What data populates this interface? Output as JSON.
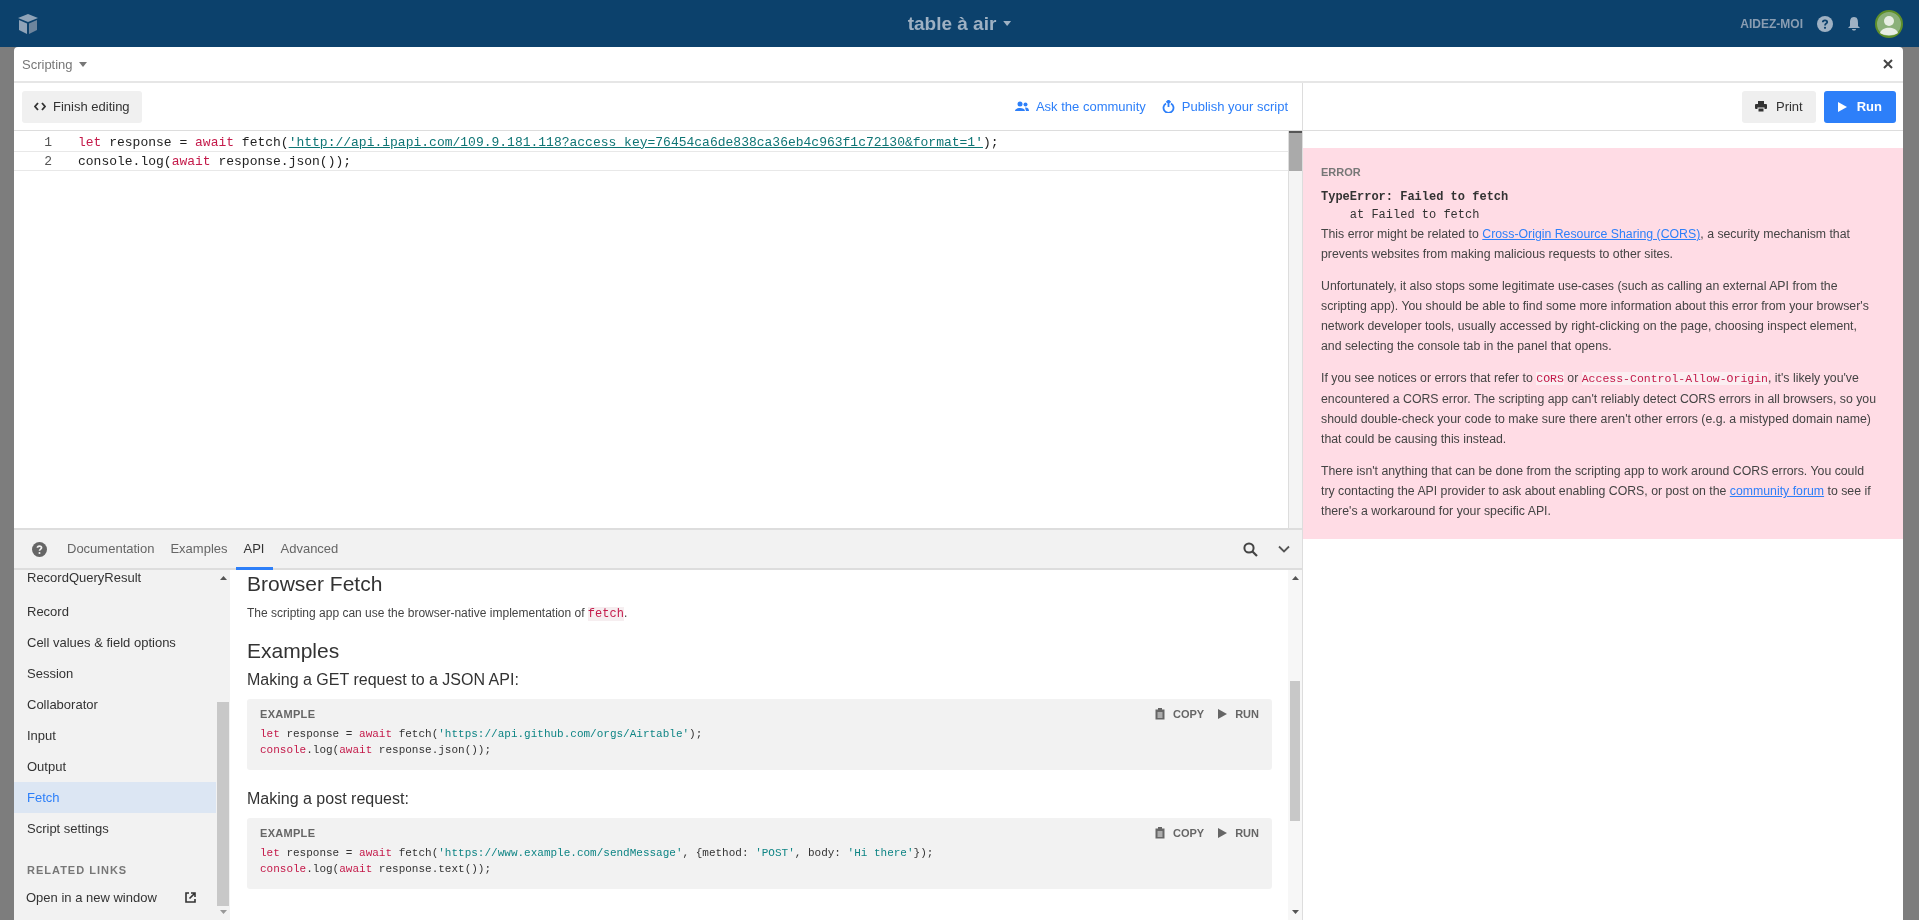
{
  "top_bar": {
    "title": "table à air",
    "help_label": "AIDEZ-MOI"
  },
  "modal": {
    "title": "Scripting"
  },
  "toolbar": {
    "finish_editing": "Finish editing",
    "ask_community": "Ask the community",
    "publish_script": "Publish your script"
  },
  "run_panel": {
    "print": "Print",
    "run": "Run"
  },
  "editor": {
    "lines": [
      {
        "number": "1",
        "tokens": [
          {
            "kind": "keyword",
            "text": "let"
          },
          {
            "kind": "plain",
            "text": " response = "
          },
          {
            "kind": "keyword",
            "text": "await"
          },
          {
            "kind": "plain",
            "text": " fetch("
          },
          {
            "kind": "link-string",
            "text": "'http://api.ipapi.com/109.9.181.118?access_key=76454ca6de838ca36eb4c963f1c72130&format=1'"
          },
          {
            "kind": "plain",
            "text": ");"
          }
        ]
      },
      {
        "number": "2",
        "tokens": [
          {
            "kind": "plain",
            "text": "console.log("
          },
          {
            "kind": "keyword",
            "text": "await"
          },
          {
            "kind": "plain",
            "text": " response.json());"
          }
        ]
      }
    ]
  },
  "docs": {
    "tabs": [
      {
        "label": "Documentation",
        "selected": false
      },
      {
        "label": "Examples",
        "selected": false
      },
      {
        "label": "API",
        "selected": true
      },
      {
        "label": "Advanced",
        "selected": false
      }
    ],
    "sidebar": {
      "items": [
        {
          "label": "RecordQueryResult",
          "selected": false
        },
        {
          "label": "Record",
          "selected": false
        },
        {
          "label": "Cell values & field options",
          "selected": false
        },
        {
          "label": "Session",
          "selected": false
        },
        {
          "label": "Collaborator",
          "selected": false
        },
        {
          "label": "Input",
          "selected": false
        },
        {
          "label": "Output",
          "selected": false
        },
        {
          "label": "Fetch",
          "selected": true
        },
        {
          "label": "Script settings",
          "selected": false
        }
      ],
      "related_heading": "RELATED LINKS",
      "related_links": [
        {
          "label": "Open in a new window"
        }
      ]
    },
    "content": {
      "heading": "Browser Fetch",
      "intro": [
        {
          "kind": "text",
          "text": "The scripting app can use the browser-native implementation of "
        },
        {
          "kind": "code",
          "text": "fetch"
        },
        {
          "kind": "text",
          "text": "."
        }
      ],
      "examples_heading": "Examples",
      "examples": [
        {
          "title": "Making a GET request to a JSON API:",
          "label": "EXAMPLE",
          "copy": "COPY",
          "run": "RUN",
          "lines": [
            [
              {
                "kind": "keyword",
                "text": "let"
              },
              {
                "kind": "plain",
                "text": " response = "
              },
              {
                "kind": "keyword",
                "text": "await"
              },
              {
                "kind": "plain",
                "text": " fetch("
              },
              {
                "kind": "string",
                "text": "'https://api.github.com/orgs/Airtable'"
              },
              {
                "kind": "plain",
                "text": ");"
              }
            ],
            [
              {
                "kind": "keyword",
                "text": "console"
              },
              {
                "kind": "plain",
                "text": ".log("
              },
              {
                "kind": "keyword",
                "text": "await"
              },
              {
                "kind": "plain",
                "text": " response.json());"
              }
            ]
          ]
        },
        {
          "title": "Making a post request:",
          "label": "EXAMPLE",
          "copy": "COPY",
          "run": "RUN",
          "lines": [
            [
              {
                "kind": "keyword",
                "text": "let"
              },
              {
                "kind": "plain",
                "text": " response = "
              },
              {
                "kind": "keyword",
                "text": "await"
              },
              {
                "kind": "plain",
                "text": " fetch("
              },
              {
                "kind": "string",
                "text": "'https://www.example.com/sendMessage'"
              },
              {
                "kind": "plain",
                "text": ", {method: "
              },
              {
                "kind": "string",
                "text": "'POST'"
              },
              {
                "kind": "plain",
                "text": ", body: "
              },
              {
                "kind": "string",
                "text": "'Hi there'"
              },
              {
                "kind": "plain",
                "text": "});"
              }
            ],
            [
              {
                "kind": "keyword",
                "text": "console"
              },
              {
                "kind": "plain",
                "text": ".log("
              },
              {
                "kind": "keyword",
                "text": "await"
              },
              {
                "kind": "plain",
                "text": " response.text());"
              }
            ]
          ]
        }
      ]
    }
  },
  "error": {
    "label": "ERROR",
    "trace": [
      "TypeError: Failed to fetch",
      "    at Failed to fetch"
    ],
    "paragraphs": [
      [
        {
          "kind": "text",
          "text": "This error might be related to "
        },
        {
          "kind": "link",
          "text": "Cross-Origin Resource Sharing (CORS)"
        },
        {
          "kind": "text",
          "text": ", a security mechanism that prevents websites from making malicious requests to other sites."
        }
      ],
      [
        {
          "kind": "text",
          "text": "Unfortunately, it also stops some legitimate use-cases (such as calling an external API from the scripting app). You should be able to find some more information about this error from your browser's network developer tools, usually accessed by right-clicking on the page, choosing inspect element, and selecting the console tab in the panel that opens."
        }
      ],
      [
        {
          "kind": "text",
          "text": "If you see notices or errors that refer to "
        },
        {
          "kind": "code",
          "text": "CORS"
        },
        {
          "kind": "text",
          "text": " or "
        },
        {
          "kind": "code",
          "text": "Access-Control-Allow-Origin"
        },
        {
          "kind": "text",
          "text": ", it's likely you've encountered a CORS error. The scripting app can't reliably detect CORS errors in all browsers, so you should double-check your code to make sure there aren't other errors (e.g. a mistyped domain name) that could be causing this instead."
        }
      ],
      [
        {
          "kind": "text",
          "text": "There isn't anything that can be done from the scripting app to work around CORS errors. You could try contacting the API provider to ask about enabling CORS, or post on the "
        },
        {
          "kind": "link",
          "text": "community forum"
        },
        {
          "kind": "text",
          "text": " to see if there's a workaround for your specific API."
        }
      ]
    ]
  }
}
